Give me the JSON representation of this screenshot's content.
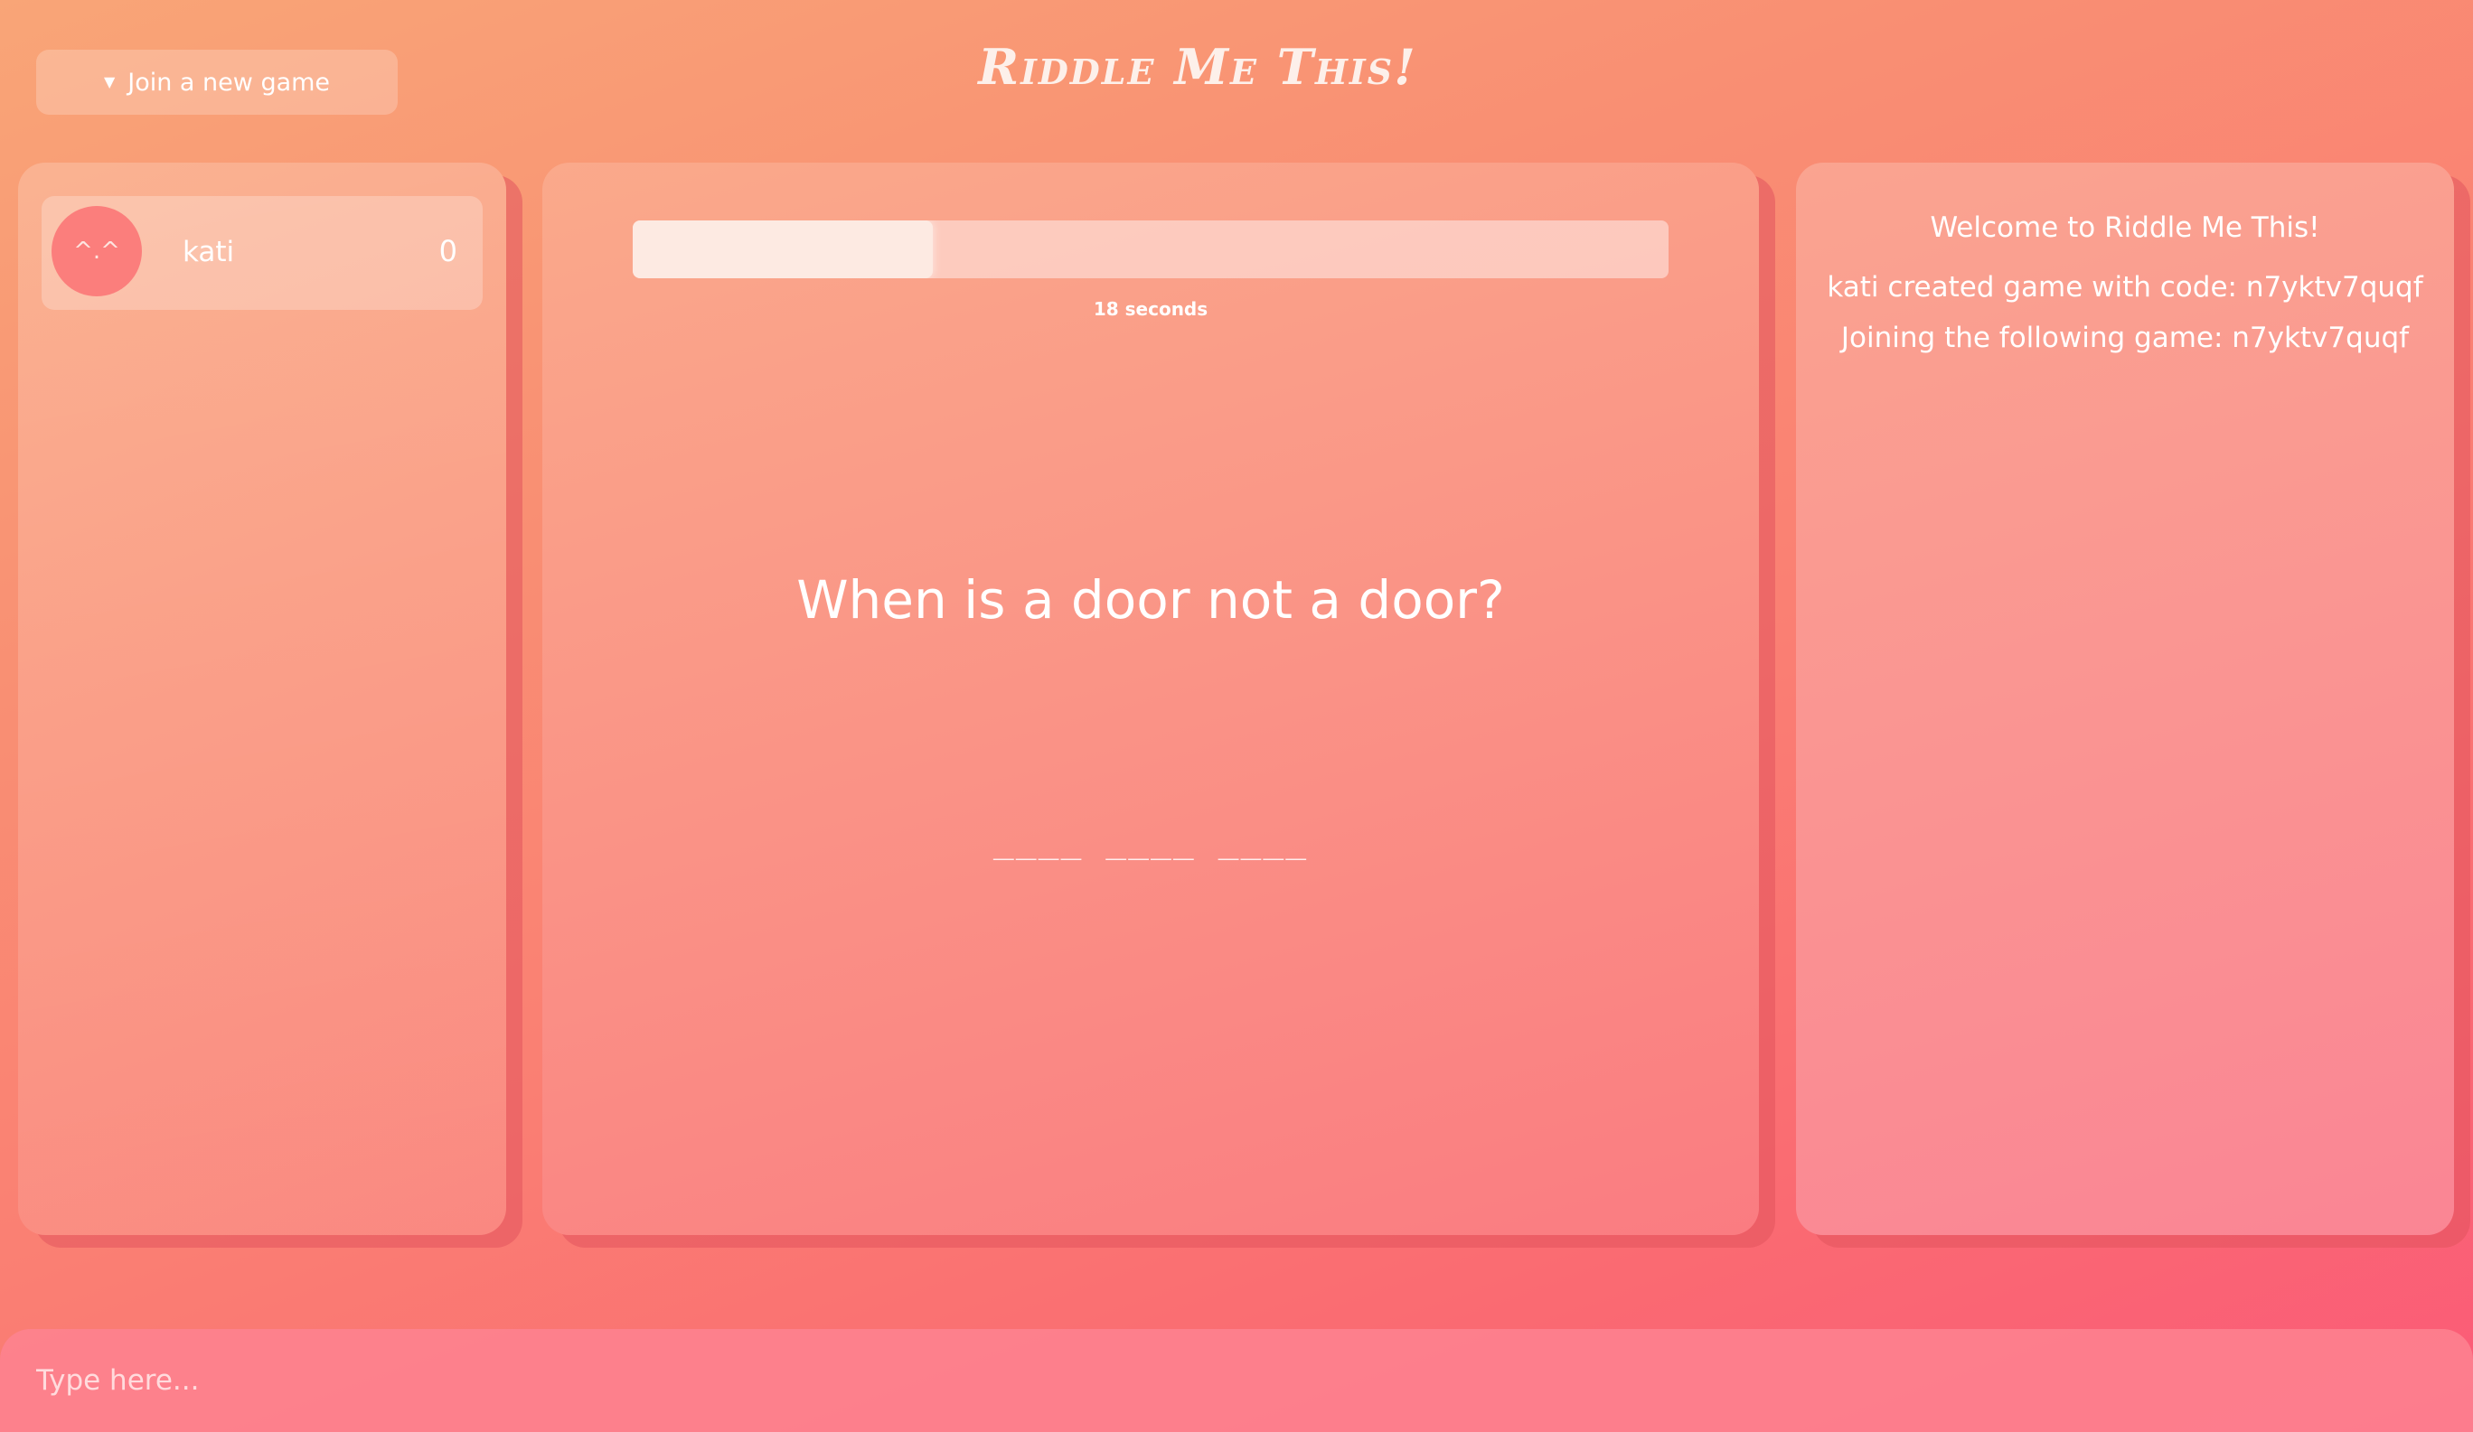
{
  "header": {
    "join_button_label": "Join a new game",
    "title": "Riddle Me This!"
  },
  "players": [
    {
      "avatar": "^.^",
      "name": "kati",
      "score": "0"
    }
  ],
  "game": {
    "timer_progress_fraction": 0.29,
    "timer_text": "18 seconds",
    "riddle": "When is a door not a door?",
    "answer_blanks": "____ ____ ____"
  },
  "log": {
    "lines": [
      "Welcome to Riddle Me This!",
      "kati created game with code: n7yktv7quqf",
      "Joining the following game: n7yktv7quqf"
    ]
  },
  "chat": {
    "placeholder": "Type here..."
  },
  "colors": {
    "accent": "#fb7e7c",
    "text": "#ffffff"
  }
}
